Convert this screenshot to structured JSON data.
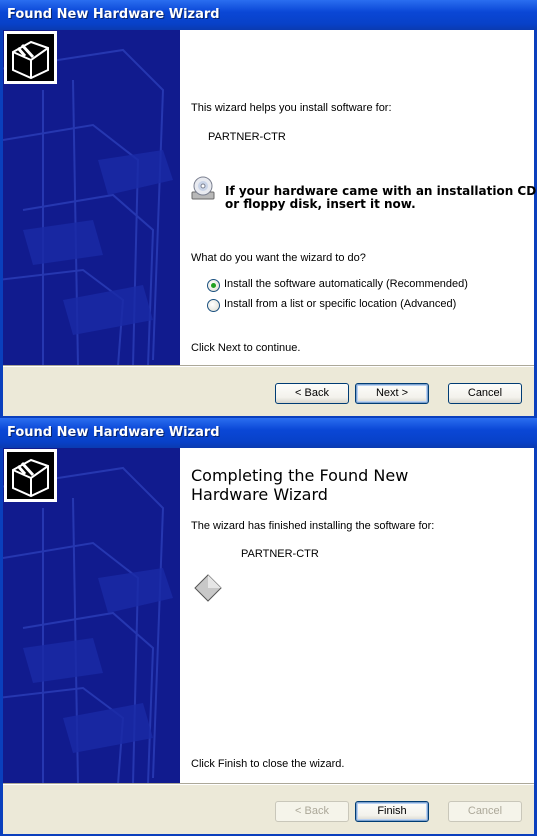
{
  "wizard1": {
    "title": "Found New Hardware Wizard",
    "intro": "This wizard helps you install software for:",
    "device": "PARTNER-CTR",
    "cd_line1": "If your hardware came with an installation CD",
    "cd_line2": "or floppy disk, insert it now.",
    "question": "What do you want the wizard to do?",
    "options": [
      {
        "label": "Install the software automatically (Recommended)",
        "checked": true
      },
      {
        "label": "Install from a list or specific location (Advanced)",
        "checked": false
      }
    ],
    "continue_text": "Click Next to continue.",
    "back_label": "< Back",
    "next_label": "Next >",
    "cancel_label": "Cancel"
  },
  "wizard2": {
    "title": "Found New Hardware Wizard",
    "heading_line1": "Completing the Found New",
    "heading_line2": "Hardware Wizard",
    "finished_text": "The wizard has finished installing the software for:",
    "device": "PARTNER-CTR",
    "close_text": "Click Finish to close the wizard.",
    "back_label": "< Back",
    "finish_label": "Finish",
    "cancel_label": "Cancel"
  },
  "icons": {
    "hardware": "hardware-box-icon",
    "cd": "cd-drive-icon",
    "device": "device-diamond-icon"
  },
  "colors": {
    "titlebar": "#0a47d6",
    "sidebar": "#101a8c",
    "footer": "#ece9d8",
    "radio_check": "#21a121"
  }
}
